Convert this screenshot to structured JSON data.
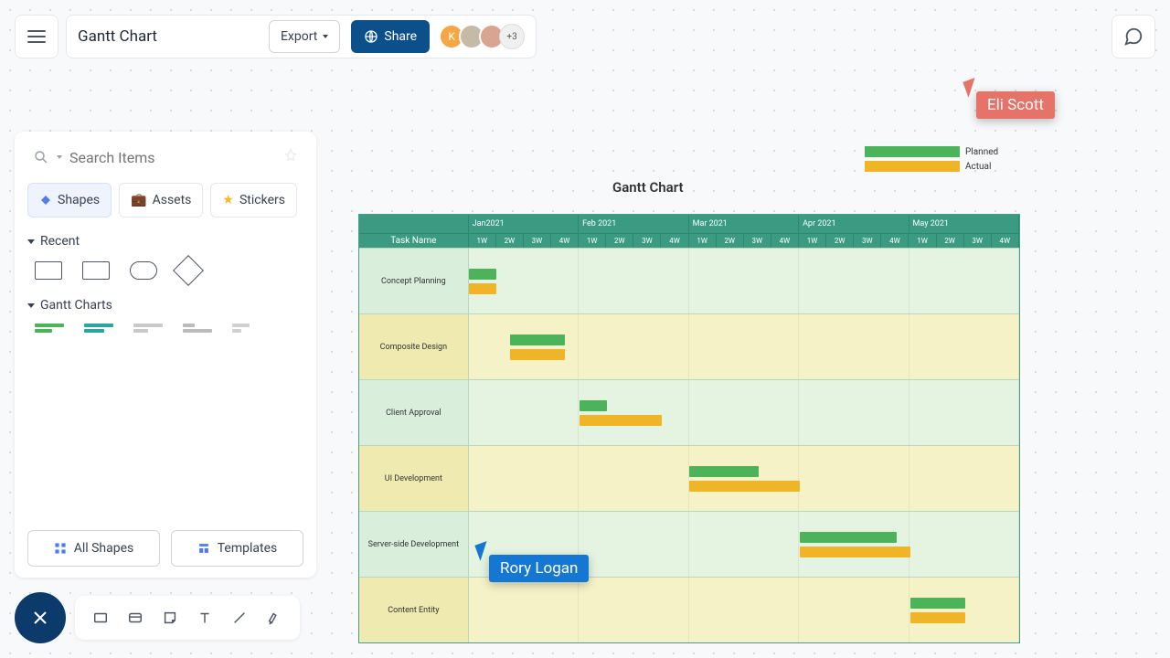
{
  "header": {
    "title": "Gantt Chart",
    "export_label": "Export",
    "share_label": "Share",
    "avatars_more": "+3"
  },
  "sidebar": {
    "search_placeholder": "Search Items",
    "tabs": {
      "shapes": "Shapes",
      "assets": "Assets",
      "stickers": "Stickers"
    },
    "sections": {
      "recent": "Recent",
      "gantt": "Gantt Charts"
    },
    "footer": {
      "all_shapes": "All Shapes",
      "templates": "Templates"
    }
  },
  "legend": {
    "planned": "Planned",
    "actual": "Actual"
  },
  "colors": {
    "planned": "#4db35a",
    "actual": "#f0b429",
    "header_bg": "#3a9b82"
  },
  "cursors": {
    "rory": "Rory Logan",
    "eli": "Eli Scott"
  },
  "chart_data": {
    "type": "gantt",
    "title": "Gantt Chart",
    "task_header": "Task Name",
    "months": [
      "Jan2021",
      "Feb 2021",
      "Mar 2021",
      "Apr 2021",
      "May 2021"
    ],
    "weeks": [
      "1W",
      "2W",
      "3W",
      "4W"
    ],
    "tasks": [
      {
        "name": "Concept Planning",
        "planned": {
          "start": 0.0,
          "span": 1.0
        },
        "actual": {
          "start": 0.0,
          "span": 1.0
        }
      },
      {
        "name": "Composite Design",
        "planned": {
          "start": 1.5,
          "span": 2.0
        },
        "actual": {
          "start": 1.5,
          "span": 2.0
        }
      },
      {
        "name": "Client Approval",
        "planned": {
          "start": 4.0,
          "span": 1.0
        },
        "actual": {
          "start": 4.0,
          "span": 3.0
        }
      },
      {
        "name": "UI Development",
        "planned": {
          "start": 8.0,
          "span": 2.5
        },
        "actual": {
          "start": 8.0,
          "span": 4.0
        }
      },
      {
        "name": "Server-side Development",
        "planned": {
          "start": 12.0,
          "span": 3.5
        },
        "actual": {
          "start": 12.0,
          "span": 4.0
        }
      },
      {
        "name": "Content Entity",
        "planned": {
          "start": 16.0,
          "span": 2.0
        },
        "actual": {
          "start": 16.0,
          "span": 2.0
        }
      }
    ],
    "unit": "weeks"
  }
}
